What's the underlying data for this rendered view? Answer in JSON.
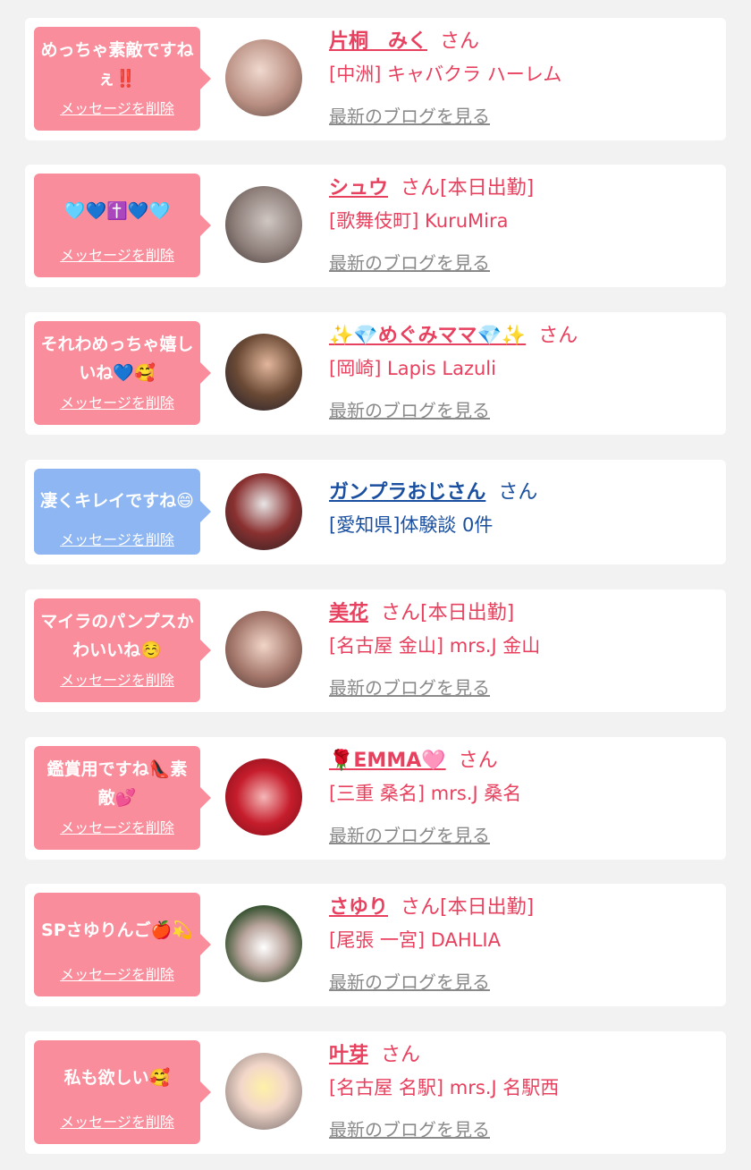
{
  "cards": [
    {
      "message": "めっちゃ素敵ですねぇ‼️",
      "delete_label": "メッセージを削除",
      "name": "片桐　みく",
      "suffix": "さん",
      "shop": "[中洲] キャバクラ ハーレム",
      "blog_link": "最新のブログを見る"
    },
    {
      "message": "🩵💙✝️💙🩵",
      "delete_label": "メッセージを削除",
      "name": "シュウ",
      "suffix": "さん[本日出勤]",
      "shop": "[歌舞伎町] KuruMira",
      "blog_link": "最新のブログを見る"
    },
    {
      "message": "それわめっちゃ嬉しいね💙🥰",
      "delete_label": "メッセージを削除",
      "name": "✨💎めぐみママ💎✨",
      "suffix": "さん",
      "shop": "[岡崎] Lapis Lazuli",
      "blog_link": "最新のブログを見る"
    },
    {
      "message": "凄くキレイですね😄",
      "delete_label": "メッセージを削除",
      "name": "ガンプラおじさん",
      "suffix": "さん",
      "shop": "[愛知県]体験談 0件",
      "blog_link": ""
    },
    {
      "message": "マイラのパンプスかわいいね☺️",
      "delete_label": "メッセージを削除",
      "name": "美花",
      "suffix": "さん[本日出勤]",
      "shop": "[名古屋 金山] mrs.J 金山",
      "blog_link": "最新のブログを見る"
    },
    {
      "message": "鑑賞用ですね👠素敵💕",
      "delete_label": "メッセージを削除",
      "name": "🌹EMMA🩷",
      "suffix": "さん",
      "shop": "[三重 桑名] mrs.J 桑名",
      "blog_link": "最新のブログを見る"
    },
    {
      "message": "SPさゆりんご🍎💫",
      "delete_label": "メッセージを削除",
      "name": "さゆり",
      "suffix": "さん[本日出勤]",
      "shop": "[尾張 一宮] DAHLIA",
      "blog_link": "最新のブログを見る"
    },
    {
      "message": "私も欲しい🥰",
      "delete_label": "メッセージを削除",
      "name": "叶芽",
      "suffix": "さん",
      "shop": "[名古屋 名駅] mrs.J 名駅西",
      "blog_link": "最新のブログを見る"
    }
  ],
  "colors": {
    "pink_bubble": "#f98d9b",
    "blue_bubble": "#8db6f2",
    "cast_name": "#e8415f",
    "user_name": "#1a4fa0",
    "blog_link": "#8a8a8a",
    "page_bg": "#f2f2f2"
  }
}
